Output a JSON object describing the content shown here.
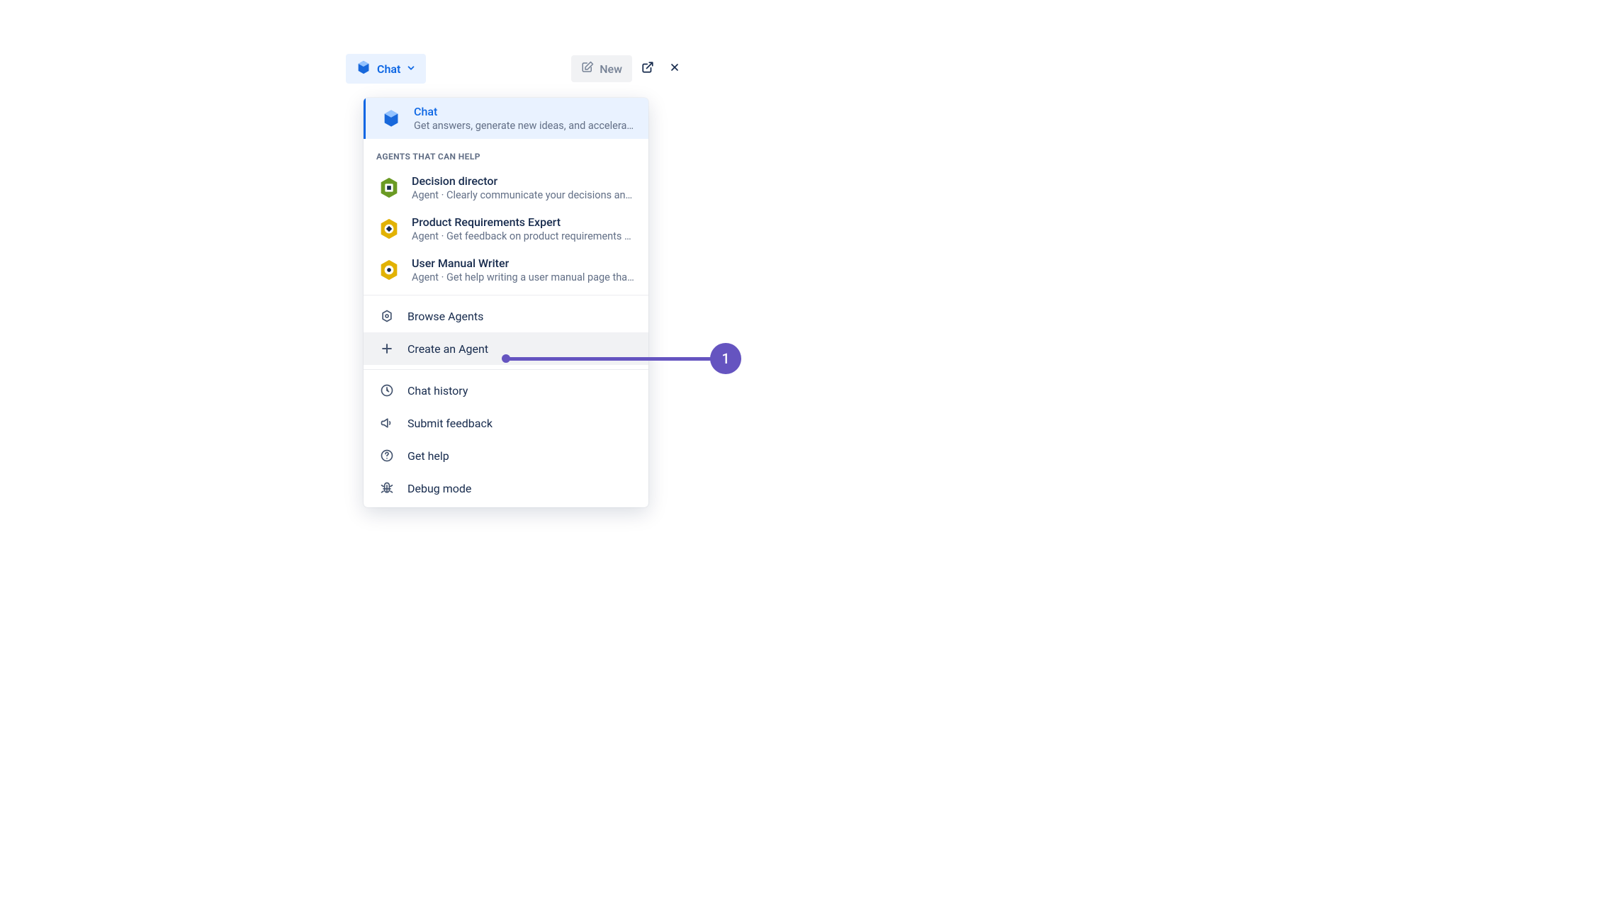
{
  "header": {
    "selector_label": "Chat",
    "new_label": "New"
  },
  "dropdown": {
    "chat_option": {
      "title": "Chat",
      "subtitle": "Get answers, generate new ideas, and accelera…"
    },
    "agents_section_label": "AGENTS THAT CAN HELP",
    "agents": [
      {
        "title": "Decision director",
        "subtitle": "Agent · Clearly communicate your decisions an…",
        "color": "#6A9A23"
      },
      {
        "title": "Product Requirements Expert",
        "subtitle": "Agent · Get feedback on product requirements …",
        "color": "#E2B203"
      },
      {
        "title": "User Manual Writer",
        "subtitle": "Agent · Get help writing a user manual page tha…",
        "color": "#E2B203"
      }
    ],
    "actions": {
      "browse": "Browse Agents",
      "create": "Create an Agent",
      "history": "Chat history",
      "feedback": "Submit feedback",
      "help": "Get help",
      "debug": "Debug mode"
    }
  },
  "annotation": {
    "number": "1"
  }
}
